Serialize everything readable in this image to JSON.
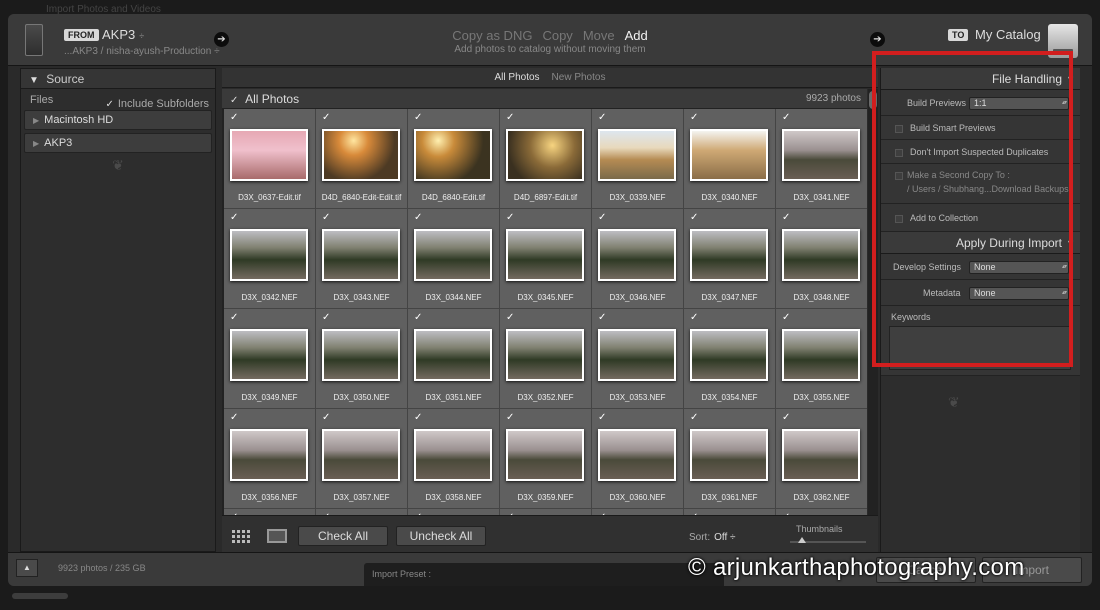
{
  "window": {
    "title": "Import Photos and Videos"
  },
  "topbar": {
    "from_tag": "FROM",
    "from_name": "AKP3",
    "from_caret": "÷",
    "from_path": "...AKP3 / nisha-ayush-Production ÷",
    "modes": [
      "Copy as DNG",
      "Copy",
      "Move",
      "Add"
    ],
    "active_mode": "Add",
    "mode_description": "Add photos to catalog without moving them",
    "to_tag": "TO",
    "to_name": "My Catalog",
    "arrow": "➔"
  },
  "source": {
    "header": "Source",
    "header_tri": "▼",
    "files_label": "Files",
    "include_subfolders": "Include Subfolders",
    "volumes": [
      "Macintosh HD",
      "AKP3"
    ],
    "volume_tri": "▶",
    "ornament": "❦"
  },
  "center": {
    "tabs": [
      "All Photos",
      "New Photos"
    ],
    "active_tab": "All Photos",
    "bar_title": "All Photos",
    "photo_count": "9923 photos",
    "checkmark": "✓",
    "photos": [
      {
        "name": "D3X_0637-Edit.tif",
        "style": "t-pink"
      },
      {
        "name": "D4D_6840-Edit-Edit.tif",
        "style": "t-sunset"
      },
      {
        "name": "D4D_6840-Edit.tif",
        "style": "t-sunset2"
      },
      {
        "name": "D4D_6897-Edit.tif",
        "style": "t-couple"
      },
      {
        "name": "D3X_0339.NEF",
        "style": "t-monument"
      },
      {
        "name": "D3X_0340.NEF",
        "style": "t-monument2"
      },
      {
        "name": "D3X_0341.NEF",
        "style": "t-dusk"
      },
      {
        "name": "D3X_0342.NEF",
        "style": "t-park"
      },
      {
        "name": "D3X_0343.NEF",
        "style": "t-park"
      },
      {
        "name": "D3X_0344.NEF",
        "style": "t-park"
      },
      {
        "name": "D3X_0345.NEF",
        "style": "t-park"
      },
      {
        "name": "D3X_0346.NEF",
        "style": "t-park"
      },
      {
        "name": "D3X_0347.NEF",
        "style": "t-park"
      },
      {
        "name": "D3X_0348.NEF",
        "style": "t-park"
      },
      {
        "name": "D3X_0349.NEF",
        "style": "t-park"
      },
      {
        "name": "D3X_0350.NEF",
        "style": "t-park"
      },
      {
        "name": "D3X_0351.NEF",
        "style": "t-park"
      },
      {
        "name": "D3X_0352.NEF",
        "style": "t-park"
      },
      {
        "name": "D3X_0353.NEF",
        "style": "t-park"
      },
      {
        "name": "D3X_0354.NEF",
        "style": "t-park"
      },
      {
        "name": "D3X_0355.NEF",
        "style": "t-park"
      },
      {
        "name": "D3X_0356.NEF",
        "style": "t-dusk"
      },
      {
        "name": "D3X_0357.NEF",
        "style": "t-dusk"
      },
      {
        "name": "D3X_0358.NEF",
        "style": "t-dusk"
      },
      {
        "name": "D3X_0359.NEF",
        "style": "t-dusk"
      },
      {
        "name": "D3X_0360.NEF",
        "style": "t-dusk"
      },
      {
        "name": "D3X_0361.NEF",
        "style": "t-dusk"
      },
      {
        "name": "D3X_0362.NEF",
        "style": "t-dusk"
      },
      {
        "name": "",
        "style": "t-dusk"
      },
      {
        "name": "",
        "style": "t-dusk"
      },
      {
        "name": "",
        "style": "t-dusk"
      },
      {
        "name": "",
        "style": "t-dusk"
      },
      {
        "name": "",
        "style": "t-dusk"
      },
      {
        "name": "",
        "style": "t-dusk"
      },
      {
        "name": "",
        "style": "t-dusk"
      }
    ]
  },
  "toolbar": {
    "check_all": "Check All",
    "uncheck_all": "Uncheck All",
    "sort_label": "Sort:",
    "sort_value": "Off ÷",
    "thumbnails_label": "Thumbnails"
  },
  "file_handling": {
    "header": "File Handling",
    "header_tri": "▼",
    "build_previews_label": "Build Previews",
    "build_previews_value": "1:1",
    "smart_previews": "Build Smart Previews",
    "no_duplicates": "Don't Import Suspected Duplicates",
    "second_copy": "Make a Second Copy To :",
    "second_copy_path": "/ Users / Shubhang...Download Backups",
    "add_to_collection": "Add to Collection"
  },
  "apply_during_import": {
    "header": "Apply During Import",
    "header_tri": "▼",
    "develop_label": "Develop Settings",
    "develop_value": "None",
    "metadata_label": "Metadata",
    "metadata_value": "None",
    "keywords_label": "Keywords",
    "ornament": "❦"
  },
  "statusbar": {
    "expand": "▲",
    "status": "9923 photos / 235 GB",
    "import_preset": "Import Preset :",
    "cancel": "Cancel",
    "import": "Import"
  },
  "watermark": "© arjunkarthaphotography.com",
  "colors": {
    "highlight": "#d21e1e",
    "background": "#2a2a2a"
  }
}
